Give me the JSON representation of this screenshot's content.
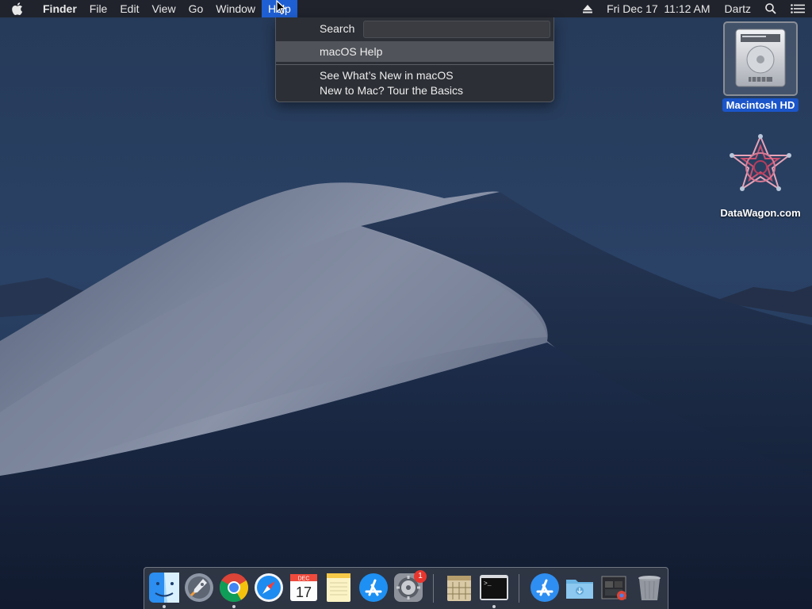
{
  "menubar": {
    "app_name": "Finder",
    "items": [
      {
        "label": "File"
      },
      {
        "label": "Edit"
      },
      {
        "label": "View"
      },
      {
        "label": "Go"
      },
      {
        "label": "Window"
      },
      {
        "label": "Help",
        "active": true
      }
    ],
    "status": {
      "eject_icon": "eject-icon",
      "datetime": "Fri Dec 17  11:12 AM",
      "user": "Dartz",
      "spotlight_icon": "search-icon",
      "notification_icon": "list-icon"
    },
    "accent": "#1f5fd4"
  },
  "help_menu": {
    "search_label": "Search",
    "search_value": "",
    "items": [
      {
        "label": "macOS Help",
        "highlighted": true
      },
      {
        "label": "See What’s New in macOS"
      },
      {
        "label": "New to Mac? Tour the Basics"
      }
    ]
  },
  "desktop": {
    "icons": [
      {
        "label": "Macintosh HD",
        "selected": true,
        "icon": "hard-drive-icon"
      },
      {
        "label": "DataWagon.com",
        "icon": "datawagon-logo-icon"
      }
    ]
  },
  "dock": {
    "apps": [
      {
        "name": "finder",
        "running": true
      },
      {
        "name": "launchpad",
        "running": false
      },
      {
        "name": "chrome",
        "running": true
      },
      {
        "name": "safari",
        "running": false
      },
      {
        "name": "calendar",
        "running": false,
        "month": "DEC",
        "day": "17"
      },
      {
        "name": "notes",
        "running": false
      },
      {
        "name": "app-store",
        "running": false
      },
      {
        "name": "system-preferences",
        "running": false,
        "badge": "1"
      },
      {
        "name": "archive-utility",
        "running": false
      },
      {
        "name": "terminal",
        "running": true
      },
      {
        "name": "applications-folder",
        "running": false
      },
      {
        "name": "downloads-folder",
        "running": false
      },
      {
        "name": "recent-screenshot",
        "running": false
      },
      {
        "name": "trash",
        "running": false
      }
    ],
    "terminal_prompt": ">_"
  }
}
